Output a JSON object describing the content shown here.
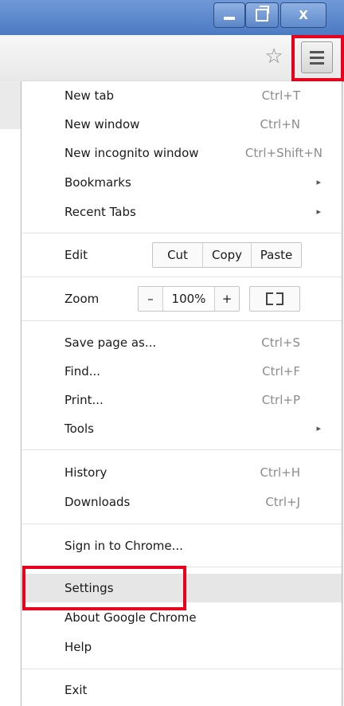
{
  "window_controls": {
    "minimize": "–",
    "close": "X"
  },
  "toolbar": {
    "bookmark_star": "☆"
  },
  "menu": {
    "group1": [
      {
        "label": "New tab",
        "accel": "Ctrl+T"
      },
      {
        "label": "New window",
        "accel": "Ctrl+N"
      },
      {
        "label": "New incognito window",
        "accel": "Ctrl+Shift+N"
      },
      {
        "label": "Bookmarks",
        "arrow": "▸"
      },
      {
        "label": "Recent Tabs",
        "arrow": "▸"
      }
    ],
    "edit": {
      "label": "Edit",
      "cut": "Cut",
      "copy": "Copy",
      "paste": "Paste"
    },
    "zoom": {
      "label": "Zoom",
      "minus": "–",
      "level": "100%",
      "plus": "+"
    },
    "group2": [
      {
        "label": "Save page as...",
        "accel": "Ctrl+S"
      },
      {
        "label": "Find...",
        "accel": "Ctrl+F"
      },
      {
        "label": "Print...",
        "accel": "Ctrl+P"
      },
      {
        "label": "Tools",
        "arrow": "▸"
      }
    ],
    "group3": [
      {
        "label": "History",
        "accel": "Ctrl+H"
      },
      {
        "label": "Downloads",
        "accel": "Ctrl+J"
      }
    ],
    "sign_in": "Sign in to Chrome...",
    "group4": [
      {
        "label": "Settings"
      },
      {
        "label": "About Google Chrome"
      },
      {
        "label": "Help"
      }
    ],
    "exit": "Exit"
  },
  "colors": {
    "highlight": "#e8001c",
    "titlebar": "#4c7ac2",
    "hover": "#e6e6e6"
  }
}
